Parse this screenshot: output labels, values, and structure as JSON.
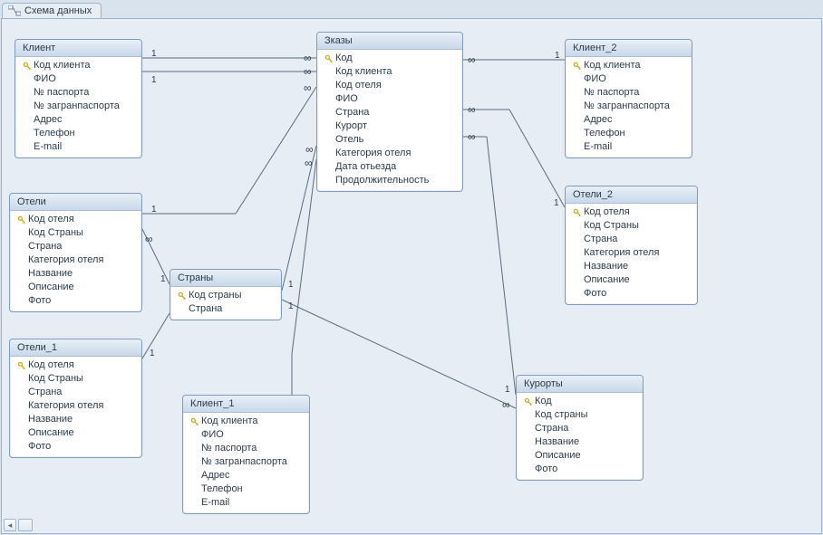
{
  "window": {
    "tab_title": "Схема данных"
  },
  "tables": {
    "klient": {
      "title": "Клиент",
      "fields": [
        {
          "pk": true,
          "label": "Код клиента"
        },
        {
          "pk": false,
          "label": "ФИО"
        },
        {
          "pk": false,
          "label": "№ паспорта"
        },
        {
          "pk": false,
          "label": "№ загранпаспорта"
        },
        {
          "pk": false,
          "label": "Адрес"
        },
        {
          "pk": false,
          "label": "Телефон"
        },
        {
          "pk": false,
          "label": "E-mail"
        }
      ]
    },
    "oteli": {
      "title": "Отели",
      "fields": [
        {
          "pk": true,
          "label": "Код отеля"
        },
        {
          "pk": false,
          "label": "Код Страны"
        },
        {
          "pk": false,
          "label": "Страна"
        },
        {
          "pk": false,
          "label": "Категория отеля"
        },
        {
          "pk": false,
          "label": "Название"
        },
        {
          "pk": false,
          "label": "Описание"
        },
        {
          "pk": false,
          "label": "Фото"
        }
      ]
    },
    "oteli1": {
      "title": "Отели_1",
      "fields": [
        {
          "pk": true,
          "label": "Код отеля"
        },
        {
          "pk": false,
          "label": "Код Страны"
        },
        {
          "pk": false,
          "label": "Страна"
        },
        {
          "pk": false,
          "label": "Категория отеля"
        },
        {
          "pk": false,
          "label": "Название"
        },
        {
          "pk": false,
          "label": "Описание"
        },
        {
          "pk": false,
          "label": "Фото"
        }
      ]
    },
    "strany": {
      "title": "Страны",
      "fields": [
        {
          "pk": true,
          "label": "Код страны"
        },
        {
          "pk": false,
          "label": "Страна"
        }
      ]
    },
    "klient1": {
      "title": "Клиент_1",
      "fields": [
        {
          "pk": true,
          "label": "Код клиента"
        },
        {
          "pk": false,
          "label": "ФИО"
        },
        {
          "pk": false,
          "label": "№ паспорта"
        },
        {
          "pk": false,
          "label": "№ загранпаспорта"
        },
        {
          "pk": false,
          "label": "Адрес"
        },
        {
          "pk": false,
          "label": "Телефон"
        },
        {
          "pk": false,
          "label": "E-mail"
        }
      ]
    },
    "zakazy": {
      "title": "Зказы",
      "fields": [
        {
          "pk": true,
          "label": "Код"
        },
        {
          "pk": false,
          "label": "Код клиента"
        },
        {
          "pk": false,
          "label": "Код отеля"
        },
        {
          "pk": false,
          "label": "ФИО"
        },
        {
          "pk": false,
          "label": "Страна"
        },
        {
          "pk": false,
          "label": "Курорт"
        },
        {
          "pk": false,
          "label": "Отель"
        },
        {
          "pk": false,
          "label": "Категория отеля"
        },
        {
          "pk": false,
          "label": "Дата отьезда"
        },
        {
          "pk": false,
          "label": "Продолжительность"
        }
      ]
    },
    "klient2": {
      "title": "Клиент_2",
      "fields": [
        {
          "pk": true,
          "label": "Код клиента"
        },
        {
          "pk": false,
          "label": "ФИО"
        },
        {
          "pk": false,
          "label": "№ паспорта"
        },
        {
          "pk": false,
          "label": "№ загранпаспорта"
        },
        {
          "pk": false,
          "label": "Адрес"
        },
        {
          "pk": false,
          "label": "Телефон"
        },
        {
          "pk": false,
          "label": "E-mail"
        }
      ]
    },
    "oteli2": {
      "title": "Отели_2",
      "fields": [
        {
          "pk": true,
          "label": "Код отеля"
        },
        {
          "pk": false,
          "label": "Код Страны"
        },
        {
          "pk": false,
          "label": "Страна"
        },
        {
          "pk": false,
          "label": "Категория отеля"
        },
        {
          "pk": false,
          "label": "Название"
        },
        {
          "pk": false,
          "label": "Описание"
        },
        {
          "pk": false,
          "label": "Фото"
        }
      ]
    },
    "kurorty": {
      "title": "Курорты",
      "fields": [
        {
          "pk": true,
          "label": "Код"
        },
        {
          "pk": false,
          "label": "Код страны"
        },
        {
          "pk": false,
          "label": "Страна"
        },
        {
          "pk": false,
          "label": "Название"
        },
        {
          "pk": false,
          "label": "Описание"
        },
        {
          "pk": false,
          "label": "Фото"
        }
      ]
    }
  },
  "relationships": [
    {
      "from": "klient",
      "to": "zakazy",
      "left_card": "1",
      "right_card": "∞"
    },
    {
      "from": "klient",
      "to": "zakazy",
      "left_card": "1",
      "right_card": "∞"
    },
    {
      "from": "oteli",
      "to": "zakazy",
      "left_card": "1",
      "right_card": "∞"
    },
    {
      "from": "oteli",
      "to": "strany",
      "left_card": "∞",
      "right_card": "1"
    },
    {
      "from": "oteli1",
      "to": "strany",
      "left_card": "1",
      "right_card": ""
    },
    {
      "from": "klient1",
      "to": "zakazy",
      "left_card": "1",
      "right_card": "∞"
    },
    {
      "from": "strany",
      "to": "zakazy",
      "left_card": "1",
      "right_card": "∞"
    },
    {
      "from": "strany",
      "to": "kurorty",
      "left_card": "1",
      "right_card": "∞"
    },
    {
      "from": "zakazy",
      "to": "klient2",
      "left_card": "∞",
      "right_card": "1"
    },
    {
      "from": "zakazy",
      "to": "oteli2",
      "left_card": "∞",
      "right_card": "1"
    },
    {
      "from": "zakazy",
      "to": "kurorty",
      "left_card": "∞",
      "right_card": "1"
    }
  ]
}
